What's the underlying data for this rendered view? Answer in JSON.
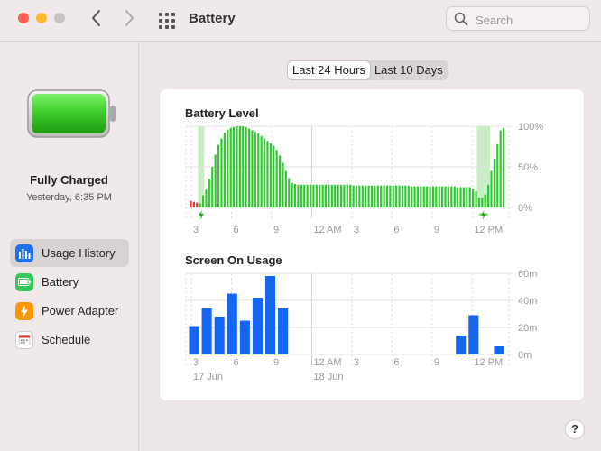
{
  "window": {
    "title": "Battery",
    "search_placeholder": "Search"
  },
  "sidebar": {
    "status_main": "Fully Charged",
    "status_sub": "Yesterday, 6:35 PM",
    "items": [
      {
        "label": "Usage History",
        "icon": "bar-chart-icon",
        "color": "#1a73e8",
        "selected": true
      },
      {
        "label": "Battery",
        "icon": "battery-icon",
        "color": "#34c759",
        "selected": false
      },
      {
        "label": "Power Adapter",
        "icon": "bolt-icon",
        "color": "#ff9500",
        "selected": false
      },
      {
        "label": "Schedule",
        "icon": "calendar-icon",
        "color": "#ffffff",
        "selected": false
      }
    ]
  },
  "tabs": [
    {
      "label": "Last 24 Hours",
      "active": true
    },
    {
      "label": "Last 10 Days",
      "active": false
    }
  ],
  "help_label": "?",
  "colors": {
    "battery_green": "#32c832",
    "battery_low": "#e0383e",
    "charging_band": "#c9eec4",
    "screen_blue": "#1565f0"
  },
  "chart_data": [
    {
      "type": "bar",
      "title": "Battery Level",
      "unit": "%",
      "ylim": [
        0,
        100
      ],
      "yticks": [
        "100%",
        "50%",
        "0%"
      ],
      "xticks": [
        "3",
        "6",
        "9",
        "12 AM",
        "3",
        "6",
        "9",
        "12 PM"
      ],
      "charging_ranges": [
        [
          2.8,
          4.8
        ],
        [
          93.7,
          98
        ]
      ],
      "low_bars": [
        0,
        1,
        2
      ],
      "values": [
        8,
        7,
        6,
        5,
        15,
        22,
        35,
        50,
        65,
        77,
        85,
        92,
        96,
        98,
        99,
        100,
        100,
        100,
        99,
        97,
        95,
        93,
        91,
        88,
        85,
        82,
        79,
        76,
        71,
        64,
        55,
        45,
        36,
        30,
        29,
        28,
        28,
        28,
        28,
        28,
        28,
        28,
        28,
        28,
        28,
        28,
        28,
        28,
        28,
        28,
        28,
        28,
        28,
        27,
        27,
        27,
        27,
        27,
        27,
        27,
        27,
        27,
        27,
        27,
        27,
        27,
        27,
        27,
        27,
        27,
        27,
        27,
        26,
        26,
        26,
        26,
        26,
        26,
        26,
        26,
        26,
        26,
        26,
        26,
        26,
        26,
        26,
        25,
        25,
        25,
        25,
        25,
        23,
        20,
        12,
        12,
        16,
        28,
        45,
        60,
        78,
        95,
        98
      ]
    },
    {
      "type": "bar",
      "title": "Screen On Usage",
      "unit": "m",
      "ylim": [
        0,
        60
      ],
      "yticks": [
        "60m",
        "40m",
        "20m",
        "0m"
      ],
      "xticks": [
        "3",
        "6",
        "9",
        "12 AM",
        "3",
        "6",
        "9",
        "12 PM"
      ],
      "date_labels": [
        {
          "label": "17 Jun",
          "at": 0
        },
        {
          "label": "18 Jun",
          "at": 3
        }
      ],
      "values": [
        21,
        34,
        28,
        45,
        25,
        42,
        58,
        34,
        0,
        0,
        0,
        0,
        0,
        0,
        0,
        0,
        0,
        0,
        0,
        0,
        0,
        14,
        29,
        0,
        6
      ]
    }
  ]
}
